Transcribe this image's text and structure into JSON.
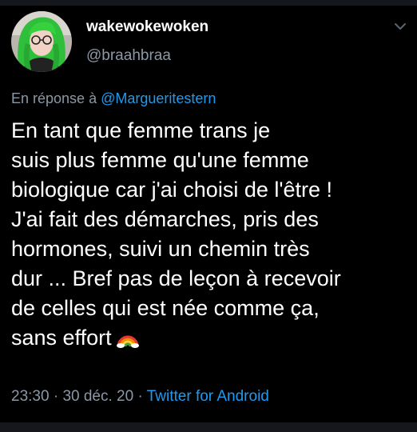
{
  "author": {
    "display_name": "wakewokewoken",
    "handle": "@braahbraa",
    "avatar": "avatar-photo-green-hair"
  },
  "reply": {
    "prefix": "En réponse à",
    "mention": "@Margueritestern"
  },
  "body": {
    "lines": [
      "En tant que femme trans je",
      "suis plus femme qu'une femme",
      "biologique car j'ai choisi de l'être !",
      "J'ai fait des démarches, pris des",
      "hormones, suivi un chemin très",
      "dur ... Bref pas de leçon à recevoir",
      "de celles qui est née comme ça,",
      "sans effort"
    ],
    "emoji": "rainbow-icon"
  },
  "meta": {
    "time": "23:30",
    "separator": "·",
    "date": "30 déc. 20",
    "client": "Twitter for Android"
  },
  "icons": {
    "more": "chevron-down-icon"
  },
  "colors": {
    "background": "#000000",
    "secondary_text": "#8b98a5",
    "link": "#1d9bf0"
  }
}
